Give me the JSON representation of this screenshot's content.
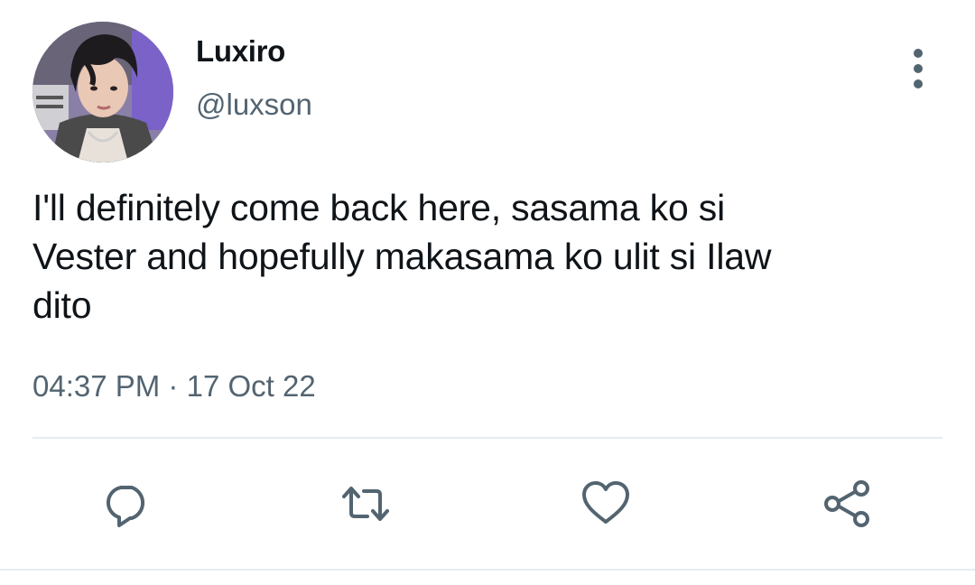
{
  "tweet": {
    "author": {
      "display_name": "Luxiro",
      "handle": "@luxson",
      "avatar_icon": "profile-photo"
    },
    "text": "I'll definitely come back here, sasama ko si\nVester and hopefully makasama ko ulit si Ilaw\ndito",
    "time": "04:37 PM",
    "separator": "·",
    "date": "17 Oct 22"
  },
  "actions": [
    {
      "name": "reply",
      "icon": "speech-bubble-icon"
    },
    {
      "name": "retweet",
      "icon": "retweet-arrows-icon"
    },
    {
      "name": "like",
      "icon": "heart-icon"
    },
    {
      "name": "share",
      "icon": "share-nodes-icon"
    }
  ],
  "menu": {
    "icon": "vertical-ellipsis-icon"
  },
  "colors": {
    "primary_text": "#0f1419",
    "secondary_text": "#536471",
    "divider": "#e6ecf0",
    "icon": "#536471"
  }
}
